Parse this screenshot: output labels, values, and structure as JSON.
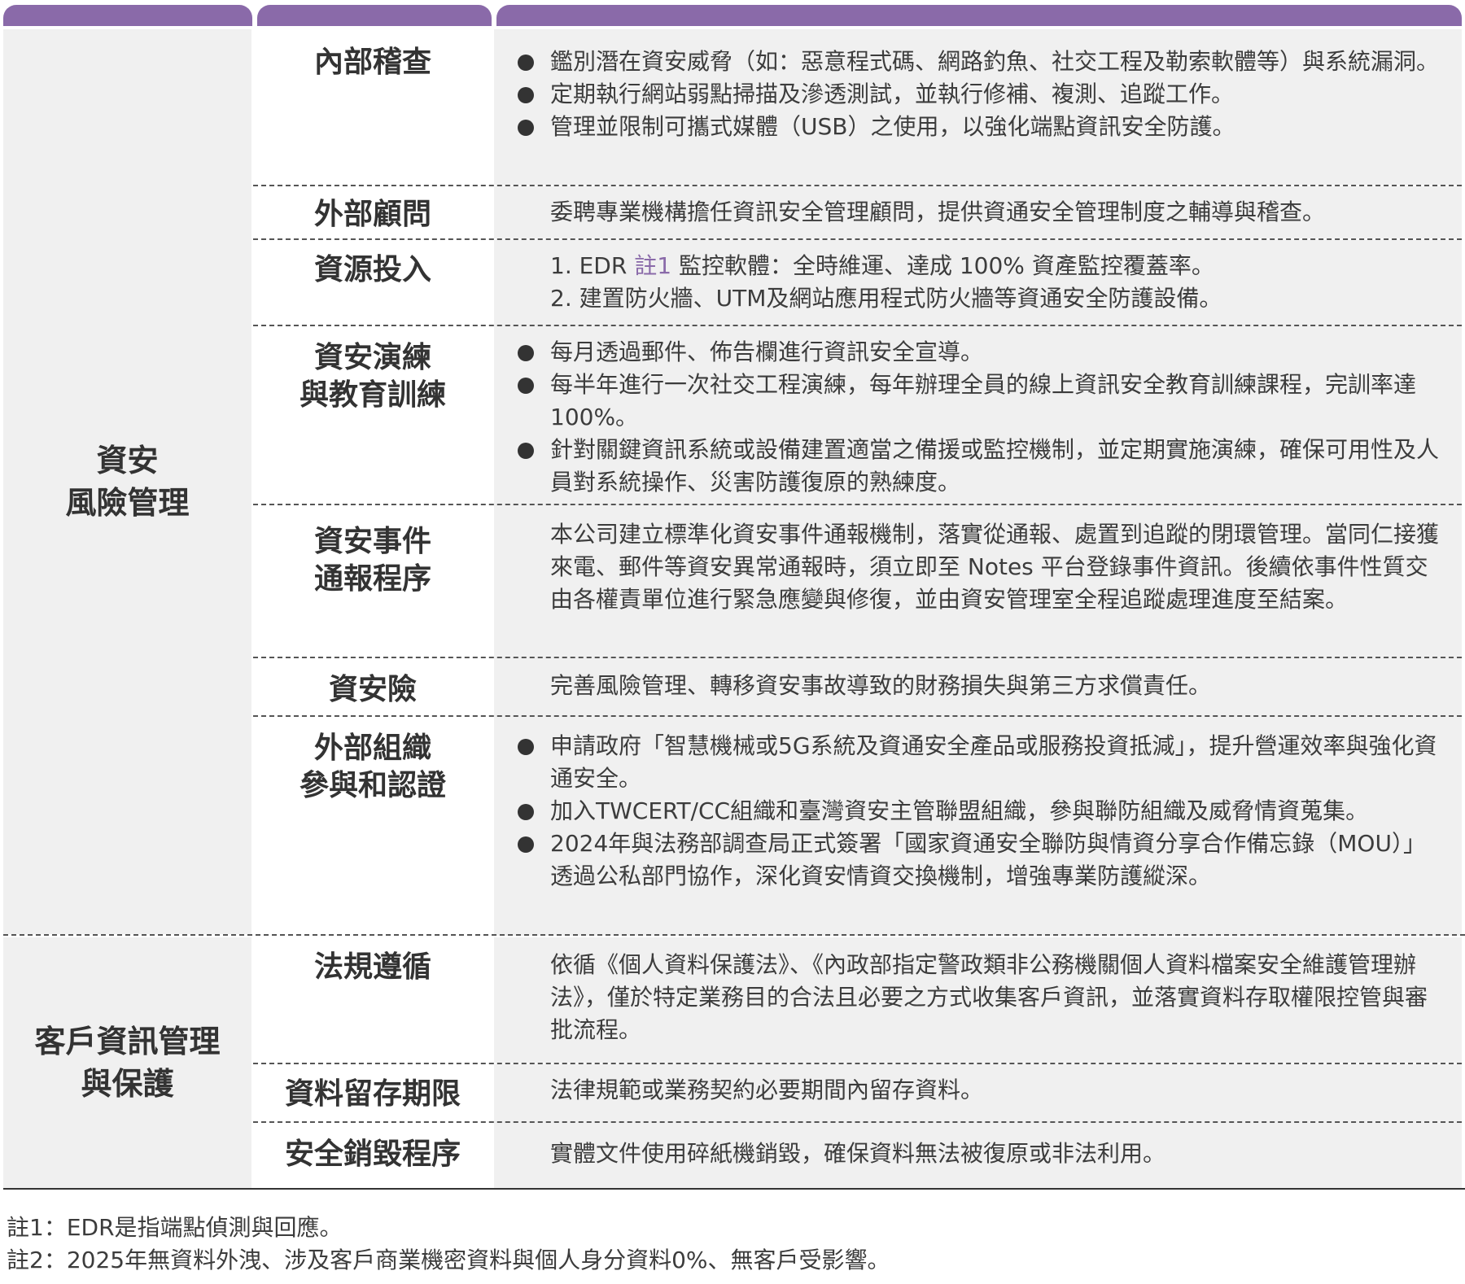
{
  "categories": [
    {
      "label": "資安\n風險管理"
    },
    {
      "label": "客戶資訊管理\n與保護"
    }
  ],
  "rows": [
    {
      "title": "內部稽查",
      "bullets": [
        "鑑別潛在資安威脅（如：惡意程式碼、網路釣魚、社交工程及勒索軟體等）與系統漏洞。",
        "定期執行網站弱點掃描及滲透測試，並執行修補、複測、追蹤工作。",
        "管理並限制可攜式媒體（USB）之使用，以強化端點資訊安全防護。"
      ]
    },
    {
      "title": "外部顧問",
      "text": "委聘專業機構擔任資訊安全管理顧問，提供資通安全管理制度之輔導與稽查。"
    },
    {
      "title": "資源投入",
      "item1_pre": "1. EDR ",
      "item1_note": "註1",
      "item1_post": " 監控軟體：全時維運、達成 100% 資產監控覆蓋率。",
      "item2": "2. 建置防火牆、UTM及網站應用程式防火牆等資通安全防護設備。"
    },
    {
      "title": "資安演練\n與教育訓練",
      "bullets": [
        "每月透過郵件、佈告欄進行資訊安全宣導。",
        "每半年進行一次社交工程演練，每年辦理全員的線上資訊安全教育訓練課程，完訓率達100%。",
        "針對關鍵資訊系統或設備建置適當之備援或監控機制，並定期實施演練，確保可用性及人員對系統操作、災害防護復原的熟練度。"
      ]
    },
    {
      "title": "資安事件\n通報程序",
      "text": "本公司建立標準化資安事件通報機制，落實從通報、處置到追蹤的閉環管理。當同仁接獲來電、郵件等資安異常通報時，須立即至 Notes 平台登錄事件資訊。後續依事件性質交由各權責單位進行緊急應變與修復，並由資安管理室全程追蹤處理進度至結案。"
    },
    {
      "title": "資安險",
      "text": "完善風險管理、轉移資安事故導致的財務損失與第三方求償責任。"
    },
    {
      "title": "外部組織\n參與和認證",
      "bullets": [
        "申請政府「智慧機械或5G系統及資通安全產品或服務投資抵減」，提升營運效率與強化資通安全。",
        "加入TWCERT/CC組織和臺灣資安主管聯盟組織，參與聯防組織及威脅情資蒐集。",
        "2024年與法務部調查局正式簽署「國家資通安全聯防與情資分享合作備忘錄（MOU）」透過公私部門協作，深化資安情資交換機制，增強專業防護縱深。"
      ]
    },
    {
      "title": "法規遵循",
      "text": "依循《個人資料保護法》、《內政部指定警政類非公務機關個人資料檔案安全維護管理辦法》，僅於特定業務目的合法且必要之方式收集客戶資訊，並落實資料存取權限控管與審批流程。"
    },
    {
      "title": "資料留存期限",
      "text": "法律規範或業務契約必要期間內留存資料。"
    },
    {
      "title": "安全銷毀程序",
      "text": "實體文件使用碎紙機銷毀，確保資料無法被復原或非法利用。"
    }
  ],
  "footnotes": [
    "註1：EDR是指端點偵測與回應。",
    "註2：2025年無資料外洩、涉及客戶商業機密資料與個人身分資料0%、無客戶受影響。"
  ],
  "colors": {
    "accent": "#8a6aa9",
    "panel": "#f0f0f0",
    "text": "#3c3c3c"
  }
}
